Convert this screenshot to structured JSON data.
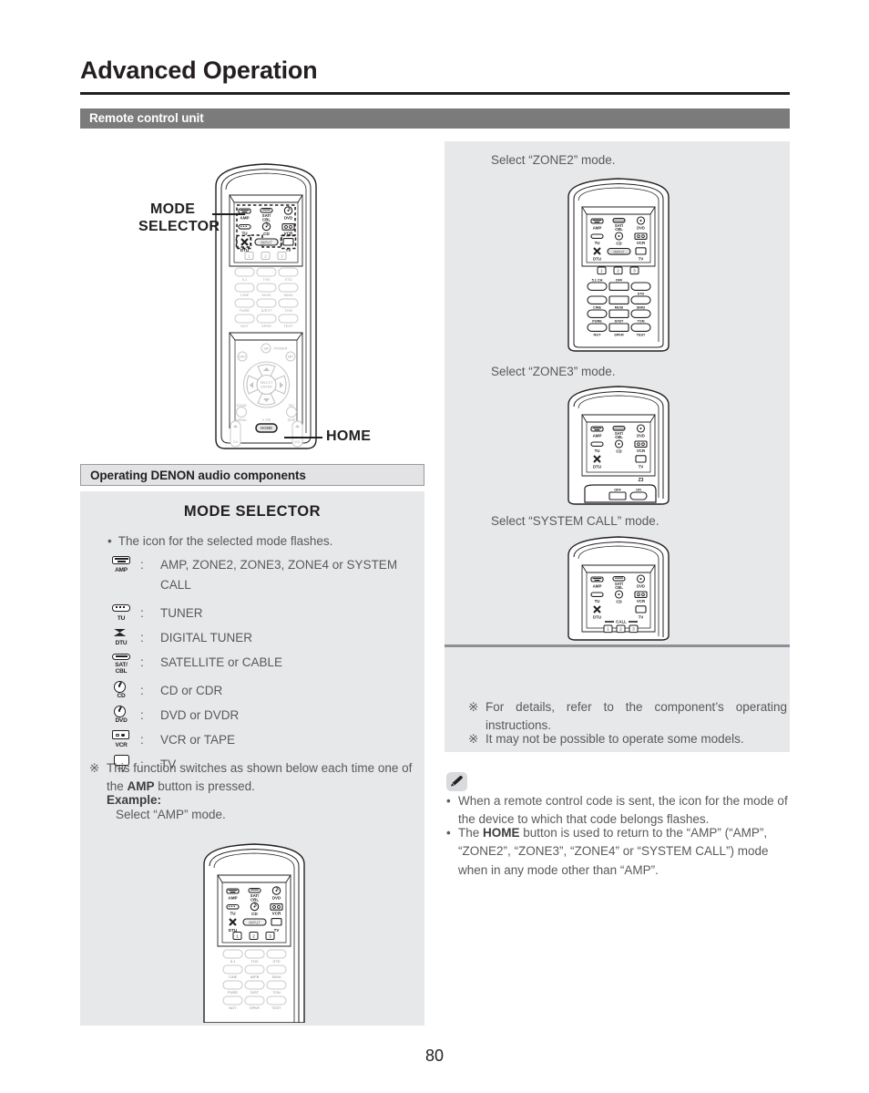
{
  "document": {
    "title": "Advanced Operation",
    "section_band": "Remote control unit",
    "sub_section_band": "Operating DENON audio components",
    "page_number": "80"
  },
  "callouts": {
    "mode_selector_line1": "MODE",
    "mode_selector_line2": "SELECTOR",
    "home": "HOME"
  },
  "mode_selector_panel": {
    "heading": "MODE SELECTOR",
    "bullet": "The icon for the selected mode flashes.",
    "rows": [
      {
        "icon": "amp-icon",
        "icon_label": "AMP",
        "colon": ":",
        "text": "AMP, ZONE2, ZONE3, ZONE4 or SYSTEM CALL"
      },
      {
        "icon": "tuner-icon",
        "icon_label": "TU",
        "colon": ":",
        "text": "TUNER"
      },
      {
        "icon": "digital-tuner-icon",
        "icon_label": "DTU",
        "colon": ":",
        "text": "DIGITAL TUNER"
      },
      {
        "icon": "satellite-cable-icon",
        "icon_label": "SAT/\nCBL",
        "colon": ":",
        "text": "SATELLITE or CABLE"
      },
      {
        "icon": "cd-icon",
        "icon_label": "CD",
        "colon": ":",
        "text": "CD or CDR"
      },
      {
        "icon": "dvd-icon",
        "icon_label": "DVD",
        "colon": ":",
        "text": "DVD or DVDR"
      },
      {
        "icon": "vcr-icon",
        "icon_label": "VCR",
        "colon": ":",
        "text": "VCR or TAPE"
      },
      {
        "icon": "tv-icon",
        "icon_label": "TV",
        "colon": ":",
        "text": "TV"
      }
    ],
    "note_marker": "※",
    "note_part1": "This function switches as shown below each time one of the ",
    "note_bold": "AMP",
    "note_part2": " button is pressed.",
    "example_label": "Example:",
    "example_text": "Select “AMP” mode."
  },
  "right_panel": {
    "zone2_caption": "Select “ZONE2” mode.",
    "zone3_caption": "Select “ZONE3” mode.",
    "system_call_caption": "Select “SYSTEM CALL” mode.",
    "notes": [
      {
        "marker": "※",
        "text": "For details, refer to the component’s operating instructions."
      },
      {
        "marker": "※",
        "text": "It may not be possible to operate some models."
      }
    ]
  },
  "bottom_notes": {
    "icon": "pencil-icon",
    "items": [
      {
        "bullet": "•",
        "pre": "When a remote control code is sent, the icon for the mode of the device to which that code belongs flashes.",
        "bold": "",
        "post": ""
      },
      {
        "bullet": "•",
        "pre": "The ",
        "bold": "HOME",
        "post": " button is used to return to the “AMP” (“AMP”, “ZONE2”, “ZONE3”, “ZONE4” or “SYSTEM CALL”) mode when in any mode other than “AMP”."
      }
    ]
  },
  "remote_buttons": {
    "mode_grid": [
      [
        "AMP",
        "SAT/CBL",
        "DVD"
      ],
      [
        "TU",
        "CD",
        "VCR"
      ],
      [
        "DTU",
        "INPUT",
        "TV"
      ]
    ],
    "numeric": [
      "1",
      "2",
      "3"
    ],
    "macro_grid": [
      [
        "5.1CH",
        "OFF",
        "STD"
      ],
      [
        "CINE",
        "MUSI",
        "SIMU"
      ],
      [
        "PURE",
        "D/EXT",
        "TON"
      ],
      [
        "NGT",
        "SPKR",
        "TEST"
      ]
    ],
    "zone3_label": "Z3",
    "zone3_toggle": [
      "OFF",
      "ON"
    ],
    "system_call_label": "CALL",
    "dpad_center": "SELECT\nENTER",
    "home_button": "HOME",
    "power_label": "POWER"
  },
  "colors": {
    "band_gray": "#7b7b7b",
    "panel_gray": "#e7e8ea",
    "subband_gray": "#e3e3e5",
    "text_gray": "#58595b",
    "ink": "#231f20"
  }
}
